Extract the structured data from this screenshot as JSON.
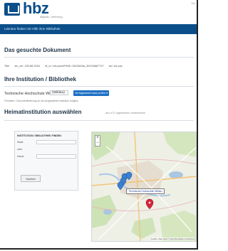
{
  "header": {
    "logo_text": "hbz",
    "logo_subtitle": "digitale, Lieferung",
    "corner_text": "Mo"
  },
  "navbar": {
    "link_label": "Literatur finden mit Hilfe ihrer Bibliothek"
  },
  "document_section": {
    "title": "Das gesuchte Dokument",
    "meta": [
      "Titel",
      "ctx_ver: Z39.88-2004",
      "rft_id: info:pmid/PMID: 80226/0ak_BV018887707",
      "sid: sfx pas"
    ]
  },
  "institution_section": {
    "title": "Ihre Institution / Bibliothek",
    "label": "Technische Hochschule Wildau",
    "select_value": "(Wildau)",
    "button_label": "Verfügbarkeit lokal prüfen",
    "note": "Fernleihe / Dokumentlieferung an die ausgewählte Institution möglich"
  },
  "home_section": {
    "title": "Heimatinstitution auswählen",
    "subtitle": "aus 472 registrierten Institutionen"
  },
  "filter_form": {
    "heading": "INSTITUTION / BIBLIOTHEK FINDEN",
    "fields": [
      {
        "label": "Stadt",
        "value": ""
      },
      {
        "label": "oder",
        "value": ""
      },
      {
        "label": "Name",
        "value": ""
      }
    ],
    "search_button": "Suchen"
  },
  "map": {
    "zoom_in": "+",
    "zoom_out": "−",
    "tooltip": "Technische Hochschule Wildau",
    "attribution": "Leaflet | Map data © OpenStreetMap contributors",
    "marker_color": "#3b7fd1",
    "selected_marker_color": "#d6263a"
  },
  "colors": {
    "brand": "#0a4f8a",
    "button": "#1d6fc4"
  }
}
